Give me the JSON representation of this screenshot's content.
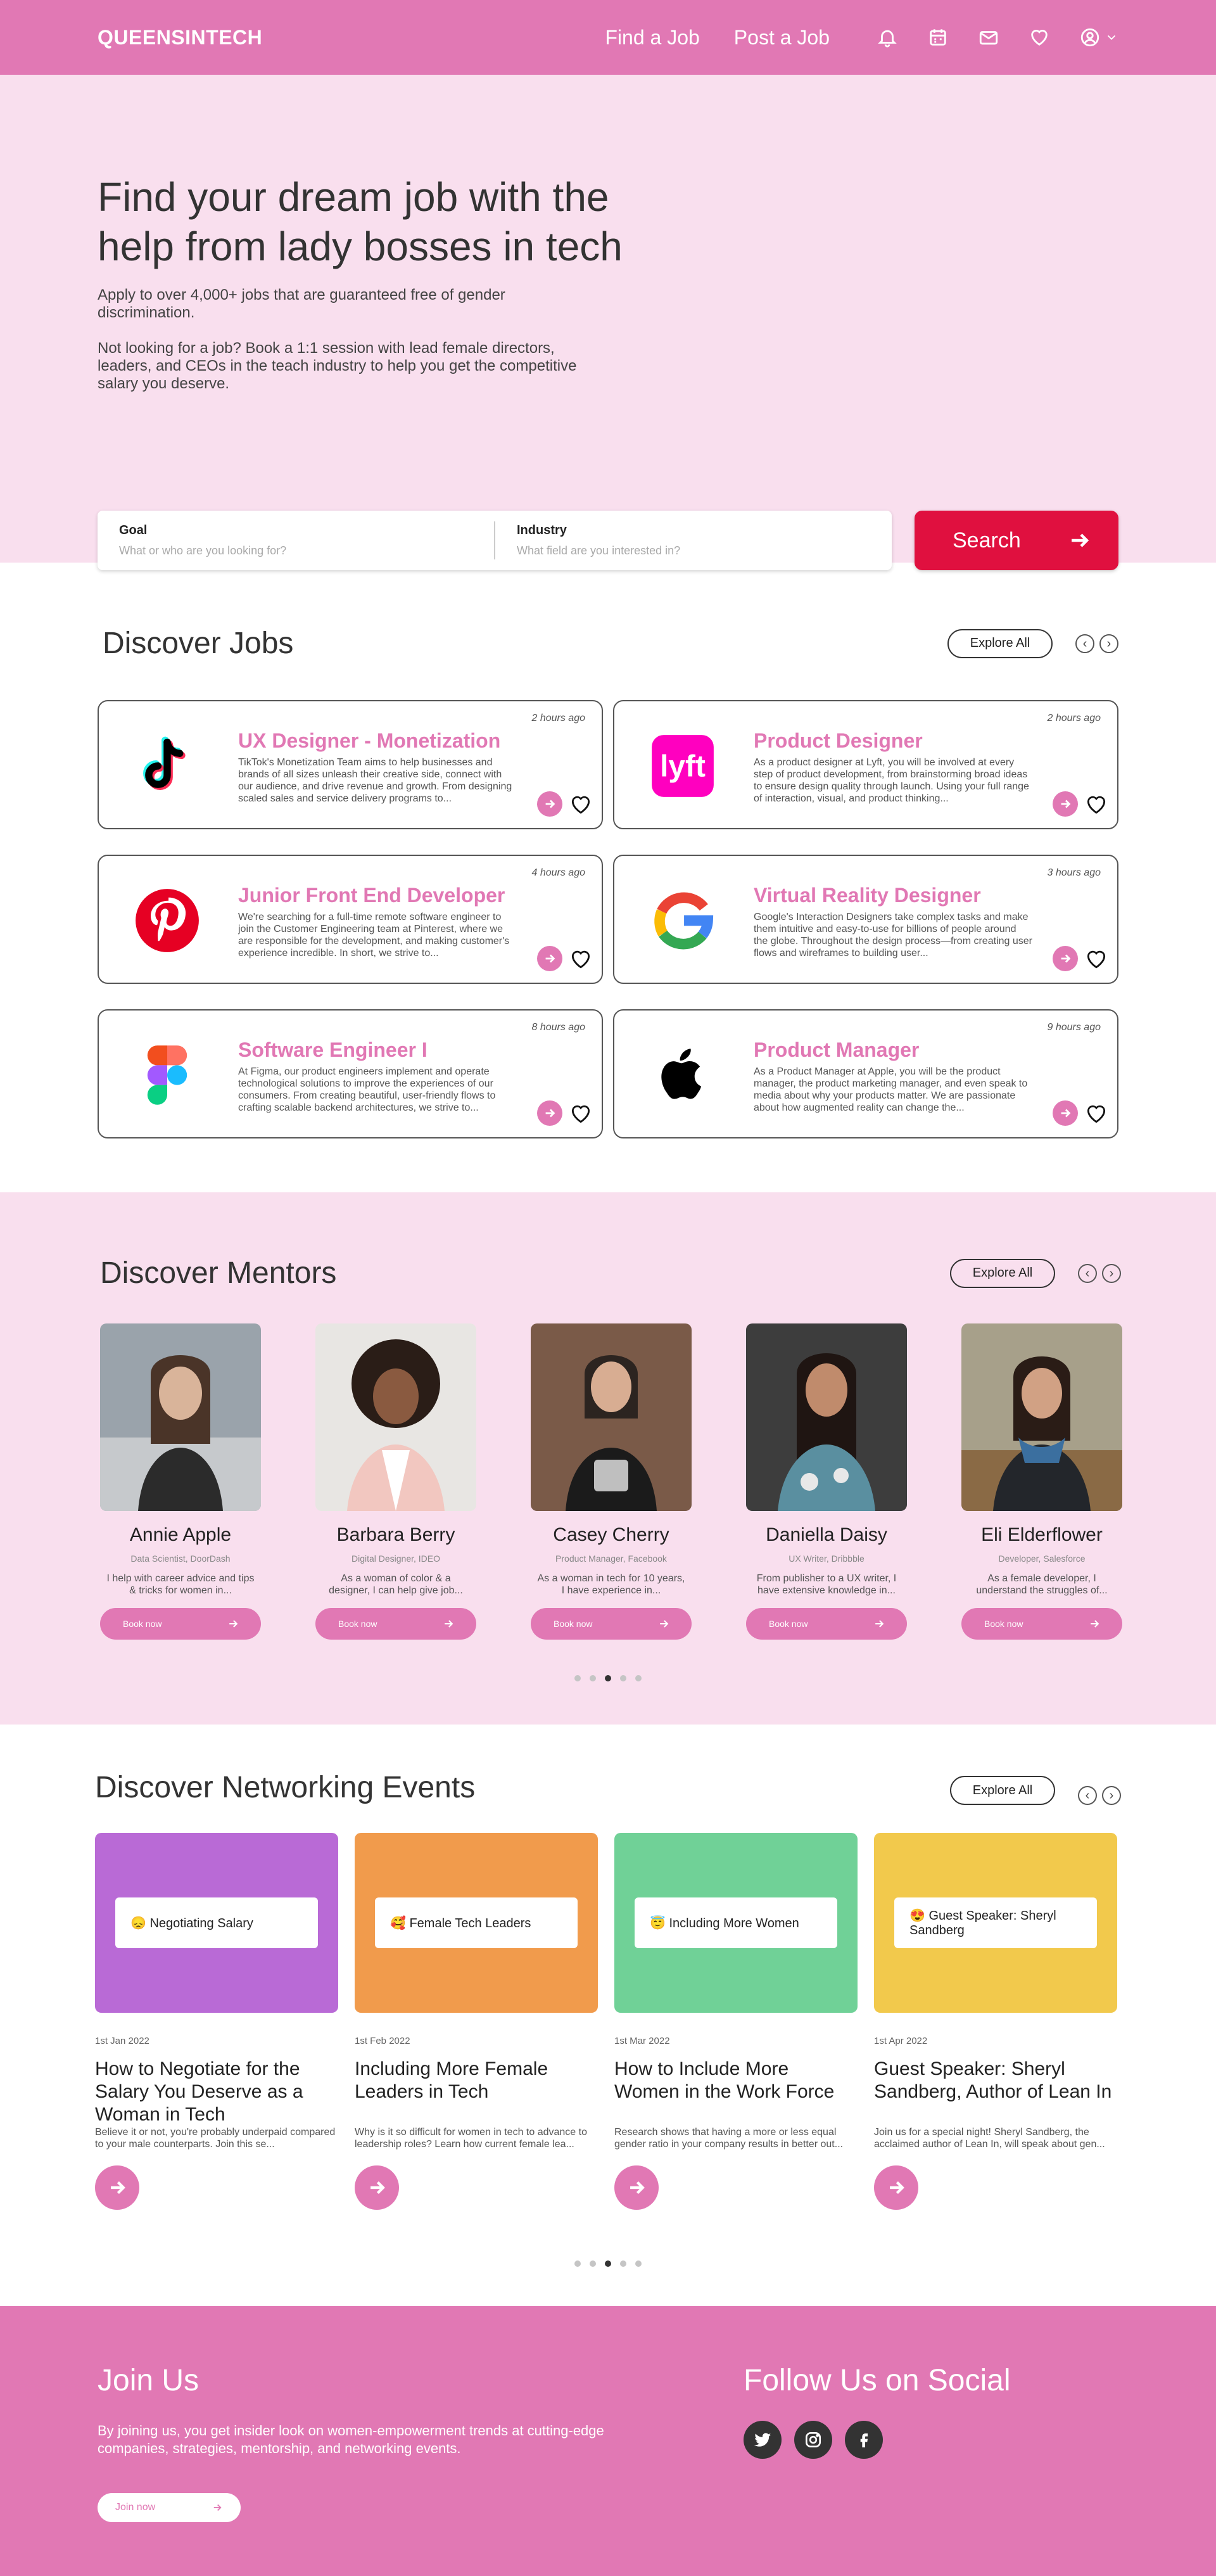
{
  "nav": {
    "brand": "QUEENSINTECH",
    "links": [
      "Find a Job",
      "Post a Job"
    ],
    "icons": [
      "bell-icon",
      "calendar-icon",
      "mail-icon",
      "heart-icon",
      "account-icon",
      "chevron-down-icon"
    ]
  },
  "hero": {
    "title": "Find your dream job with the help from lady bosses in tech",
    "p1": "Apply to over 4,000+ jobs that are guaranteed free of gender discrimination.",
    "p2": "Not looking for a job? Book a 1:1 session with lead female directors, leaders, and CEOs in the teach industry to help you get the competitive salary you deserve.",
    "goal_label": "Goal",
    "goal_placeholder": "What or who are you looking for?",
    "industry_label": "Industry",
    "industry_placeholder": "What field are you interested in?",
    "search_label": "Search"
  },
  "jobs": {
    "title": "Discover Jobs",
    "explore": "Explore All",
    "items": [
      {
        "logo": "tiktok-logo",
        "title": "UX Designer - Monetization",
        "time": "2 hours ago",
        "desc": "TikTok's Monetization Team aims to help businesses and brands of all sizes unleash their creative side, connect with our audience, and drive revenue and growth. From designing scaled sales and service delivery programs to..."
      },
      {
        "logo": "lyft-logo",
        "title": "Product Designer",
        "time": "2 hours ago",
        "desc": "As a product designer at Lyft, you will be involved at every step of product development, from brainstorming broad ideas to ensure design quality through launch. Using your full range of interaction, visual, and product thinking..."
      },
      {
        "logo": "pinterest-logo",
        "title": "Junior Front End Developer",
        "time": "4 hours ago",
        "desc": "We're searching for a full-time remote software engineer to join the Customer Engineering team at Pinterest, where we are responsible for the development, and making customer's experience incredible. In short, we strive to..."
      },
      {
        "logo": "google-logo",
        "title": "Virtual Reality Designer",
        "time": "3 hours ago",
        "desc": "Google's Interaction Designers take complex tasks and make them intuitive and easy-to-use for billions of people around the globe. Throughout the design process—from creating user flows and wireframes to building user..."
      },
      {
        "logo": "figma-logo",
        "title": "Software Engineer I",
        "time": "8 hours ago",
        "desc": "At Figma, our product engineers implement and operate technological solutions to improve the experiences of our consumers. From creating beautiful, user-friendly flows to crafting scalable backend architectures, we strive to..."
      },
      {
        "logo": "apple-logo",
        "title": "Product Manager",
        "time": "9 hours ago",
        "desc": "As a Product Manager at Apple, you will be the product manager, the product marketing manager, and even speak to media about why your products matter. We are passionate about how augmented reality can change the..."
      }
    ]
  },
  "mentors": {
    "title": "Discover Mentors",
    "explore": "Explore All",
    "book_label": "Book now",
    "items": [
      {
        "name": "Annie Apple",
        "role": "Data Scientist, DoorDash",
        "desc": "I help with career advice and tips & tricks for women in..."
      },
      {
        "name": "Barbara Berry",
        "role": "Digital Designer, IDEO",
        "desc": "As a woman of color & a designer, I can help give job..."
      },
      {
        "name": "Casey Cherry",
        "role": "Product Manager, Facebook",
        "desc": "As a woman in tech for 10 years, I have experience in..."
      },
      {
        "name": "Daniella Daisy",
        "role": "UX Writer, Dribbble",
        "desc": "From publisher to a UX writer, I have extensive knowledge in..."
      },
      {
        "name": "Eli Elderflower",
        "role": "Developer, Salesforce",
        "desc": "As a female developer, I understand the struggles of..."
      }
    ],
    "active_page": 3,
    "pages": 5
  },
  "events": {
    "title": "Discover Networking Events",
    "explore": "Explore All",
    "items": [
      {
        "color": "#b96ad6",
        "chip": "😞 Negotiating Salary",
        "date": "1st Jan 2022",
        "title": "How to Negotiate for the Salary You Deserve as a Woman in Tech",
        "desc": "Believe it or not, you're probably underpaid compared to your male counterparts. Join this se..."
      },
      {
        "color": "#f19b4c",
        "chip": "🥰 Female Tech Leaders",
        "date": "1st Feb 2022",
        "title": "Including More Female Leaders in Tech",
        "desc": "Why is it so difficult for women in tech to advance to leadership roles? Learn how current female lea..."
      },
      {
        "color": "#70d197",
        "chip": "😇 Including More Women",
        "date": "1st Mar 2022",
        "title": "How to Include More Women in the Work Force",
        "desc": "Research shows that having a more or less equal gender ratio in your company results in better out..."
      },
      {
        "color": "#f2c94c",
        "chip": "😍 Guest Speaker: Sheryl Sandberg",
        "date": "1st Apr 2022",
        "title": "Guest Speaker: Sheryl Sandberg, Author of Lean In",
        "desc": "Join us for a special night! Sheryl Sandberg, the acclaimed author of Lean In, will speak about gen..."
      }
    ]
  },
  "footer": {
    "join_title": "Join Us",
    "join_text": "By joining us, you get insider look on women-empowerment trends at cutting-edge companies, strategies, mentorship, and networking events.",
    "join_button": "Join now",
    "social_title": "Follow Us on Social",
    "social_icons": [
      "twitter-icon",
      "instagram-icon",
      "facebook-icon"
    ]
  }
}
